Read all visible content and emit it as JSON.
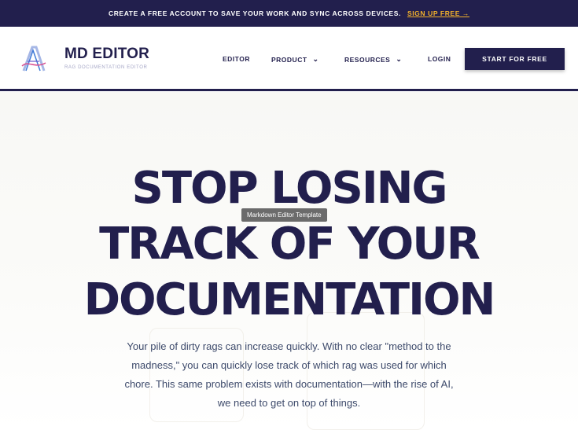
{
  "promo": {
    "message": "CREATE A FREE ACCOUNT TO SAVE YOUR WORK AND SYNC ACROSS DEVICES.",
    "link_label": "SIGN UP FREE →"
  },
  "brand": {
    "name": "MD EDITOR",
    "tagline": "RAG DOCUMENTATION EDITOR"
  },
  "nav": {
    "editor": "EDITOR",
    "product": "PRODUCT",
    "resources": "RESOURCES",
    "login": "LOGIN",
    "cta": "START FOR FREE",
    "chevron": "⌄"
  },
  "hero": {
    "line1": "STOP LOSING",
    "line2": "TRACK OF YOUR",
    "line3": "DOCUMENTATION",
    "tooltip": "Markdown Editor Template",
    "body": "Your pile of dirty rags can increase quickly. With no clear \"method to the madness,\" you can quickly lose track of which rag was used for which chore. This same problem exists with documentation—with the rise of AI, we need to get on top of things."
  },
  "colors": {
    "navy": "#221f4d",
    "accent": "#f5b32b",
    "body_text": "#3d4a6b"
  }
}
